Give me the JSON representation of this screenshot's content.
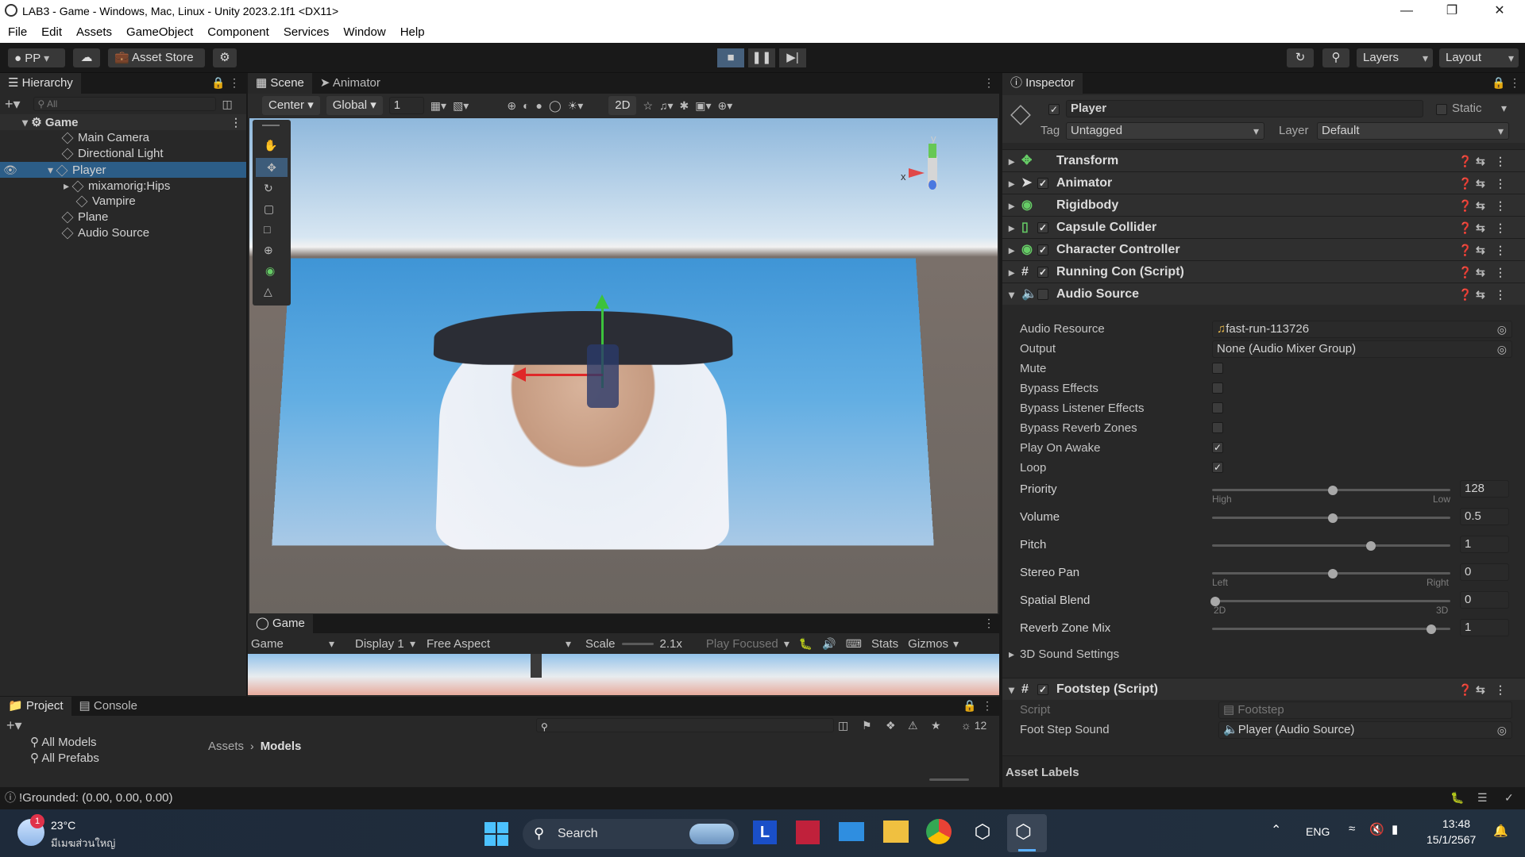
{
  "title": "LAB3 - Game - Windows, Mac, Linux - Unity 2023.2.1f1 <DX11>",
  "menu": [
    "File",
    "Edit",
    "Assets",
    "GameObject",
    "Component",
    "Services",
    "Window",
    "Help"
  ],
  "toolbar": {
    "account": "PP",
    "asset_store": "Asset Store",
    "layers": "Layers",
    "layout": "Layout"
  },
  "hierarchy": {
    "tab": "Hierarchy",
    "search_placeholder": "All",
    "items": [
      {
        "label": "Game",
        "depth": 0
      },
      {
        "label": "Main Camera",
        "depth": 1
      },
      {
        "label": "Directional Light",
        "depth": 1
      },
      {
        "label": "Player",
        "depth": 1
      },
      {
        "label": "mixamorig:Hips",
        "depth": 2
      },
      {
        "label": "Vampire",
        "depth": 2
      },
      {
        "label": "Plane",
        "depth": 1
      },
      {
        "label": "Audio Source",
        "depth": 1
      }
    ]
  },
  "scene": {
    "tabs": [
      "Scene",
      "Animator"
    ],
    "pivot": "Center",
    "space": "Global",
    "grid_value": "1",
    "mode_2d": "2D",
    "gizmo_x": "x",
    "gizmo_y": "y"
  },
  "game": {
    "tab": "Game",
    "view": "Game",
    "display": "Display 1",
    "aspect": "Free Aspect",
    "scale_label": "Scale",
    "scale_value": "2.1x",
    "play_focused": "Play Focused",
    "stats": "Stats",
    "gizmos": "Gizmos"
  },
  "project": {
    "tabs": [
      "Project",
      "Console"
    ],
    "favorites": [
      "All Models",
      "All Prefabs"
    ],
    "breadcrumb": [
      "Assets",
      "Models"
    ],
    "hidden_count": "12"
  },
  "status": {
    "message": "!Grounded: (0.00, 0.00, 0.00)"
  },
  "inspector": {
    "tab": "Inspector",
    "object_name": "Player",
    "static_label": "Static",
    "tag_label": "Tag",
    "tag_value": "Untagged",
    "layer_label": "Layer",
    "layer_value": "Default",
    "components": [
      "Transform",
      "Animator",
      "Rigidbody",
      "Capsule Collider",
      "Character Controller",
      "Running Con (Script)",
      "Audio Source"
    ],
    "audio": {
      "resource_label": "Audio Resource",
      "resource_value": "fast-run-113726",
      "output_label": "Output",
      "output_value": "None (Audio Mixer Group)",
      "mute": "Mute",
      "bypass_effects": "Bypass Effects",
      "bypass_listener": "Bypass Listener Effects",
      "bypass_reverb": "Bypass Reverb Zones",
      "play_on_awake": "Play On Awake",
      "loop": "Loop",
      "priority_label": "Priority",
      "priority_value": "128",
      "priority_min": "High",
      "priority_max": "Low",
      "volume_label": "Volume",
      "volume_value": "0.5",
      "pitch_label": "Pitch",
      "pitch_value": "1",
      "stereo_label": "Stereo Pan",
      "stereo_value": "0",
      "stereo_min": "Left",
      "stereo_max": "Right",
      "spatial_label": "Spatial Blend",
      "spatial_value": "0",
      "spatial_min": "2D",
      "spatial_max": "3D",
      "reverb_label": "Reverb Zone Mix",
      "reverb_value": "1",
      "sound3d": "3D Sound Settings"
    },
    "footstep": {
      "title": "Footstep (Script)",
      "script_label": "Script",
      "script_value": "Footstep",
      "sound_label": "Foot Step Sound",
      "sound_value": "Player (Audio Source)"
    },
    "asset_labels": "Asset Labels"
  },
  "taskbar": {
    "temp": "23°C",
    "weather": "มีเมฆส่วนใหญ่",
    "badge": "1",
    "search": "Search",
    "lang": "ENG",
    "time": "13:48",
    "date": "15/1/2567"
  }
}
